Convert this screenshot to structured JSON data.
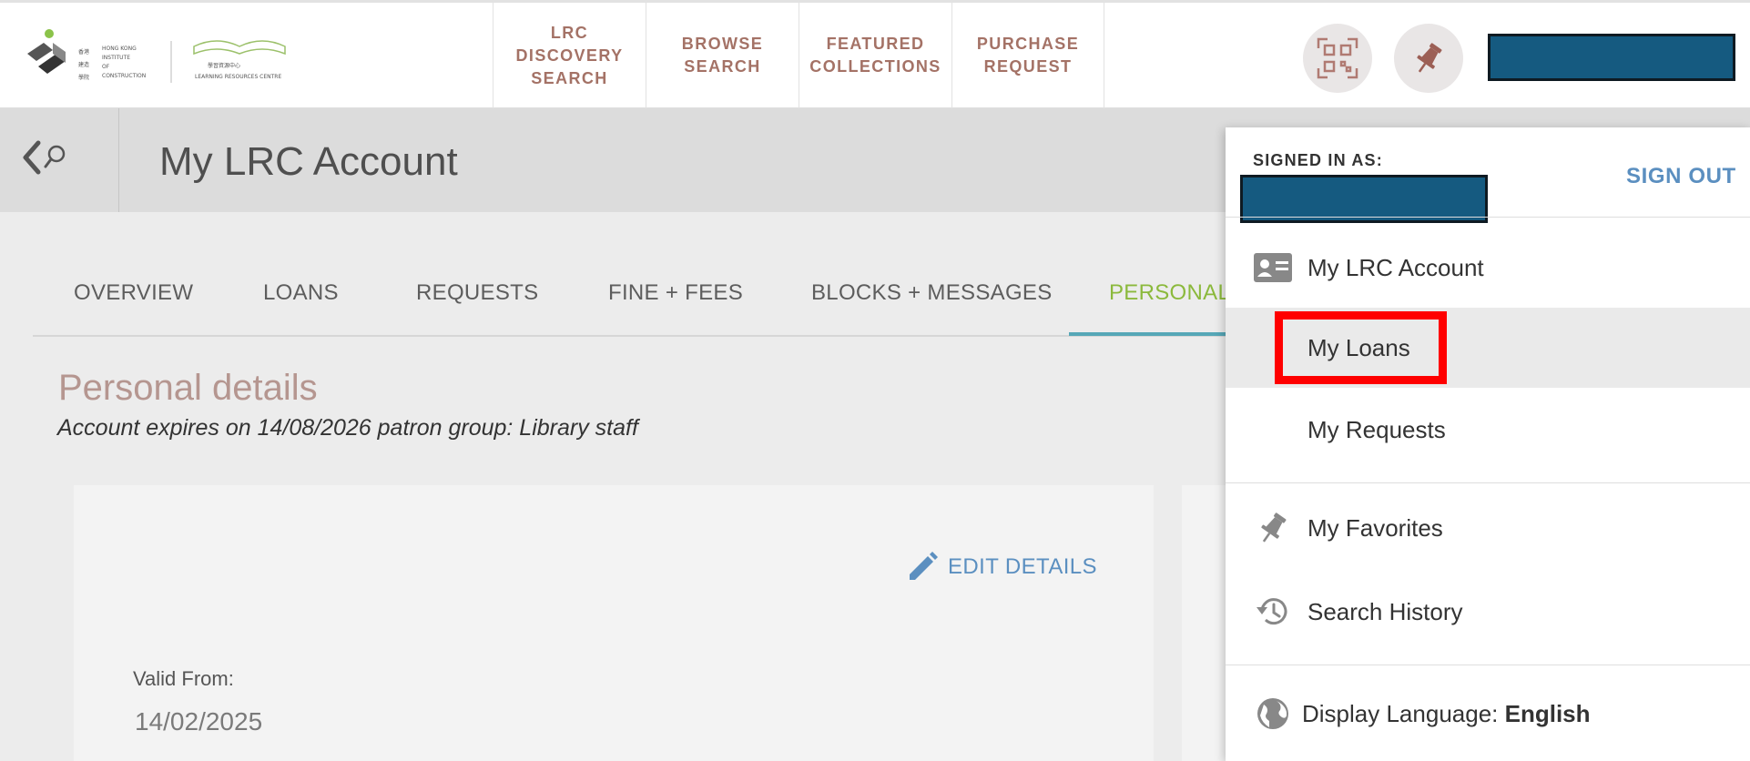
{
  "logo": {
    "institute_lines": [
      "HONG KONG",
      "INSTITUTE",
      "OF",
      "CONSTRUCTION"
    ],
    "chinese_name": "香港建造學院",
    "lrc_chinese": "學習資源中心",
    "lrc_english": "LEARNING RESOURCES CENTRE"
  },
  "nav": [
    {
      "label": "LRC\nDISCOVERY\nSEARCH"
    },
    {
      "label": "BROWSE\nSEARCH"
    },
    {
      "label": "FEATURED\nCOLLECTIONS"
    },
    {
      "label": "PURCHASE\nREQUEST"
    }
  ],
  "page": {
    "title": "My LRC Account"
  },
  "tabs": [
    {
      "label": "OVERVIEW"
    },
    {
      "label": "LOANS"
    },
    {
      "label": "REQUESTS"
    },
    {
      "label": "FINE + FEES"
    },
    {
      "label": "BLOCKS + MESSAGES"
    },
    {
      "label": "PERSONAL"
    }
  ],
  "personal": {
    "title": "Personal details",
    "subtitle": "Account expires on 14/08/2026 patron group: Library staff",
    "edit_label": "EDIT DETAILS",
    "valid_from_label": "Valid From:",
    "valid_from_value": "14/02/2025"
  },
  "dropdown": {
    "signed_in_label": "SIGNED IN AS:",
    "sign_out_label": "SIGN OUT",
    "items": [
      {
        "label": "My LRC Account",
        "icon": "id-card-icon"
      },
      {
        "label": "My Loans",
        "icon": ""
      },
      {
        "label": "My Requests",
        "icon": ""
      },
      {
        "label": "My Favorites",
        "icon": "pin-icon"
      },
      {
        "label": "Search History",
        "icon": "history-icon"
      }
    ],
    "language_label": "Display Language:",
    "language_value": "English"
  },
  "colors": {
    "nav_text": "#a47266",
    "active_tab": "#8bb93c",
    "tab_underline": "#56a7b7",
    "link_blue": "#5b8fc0",
    "redaction": "#155a80",
    "highlight_border": "#ff0000"
  }
}
